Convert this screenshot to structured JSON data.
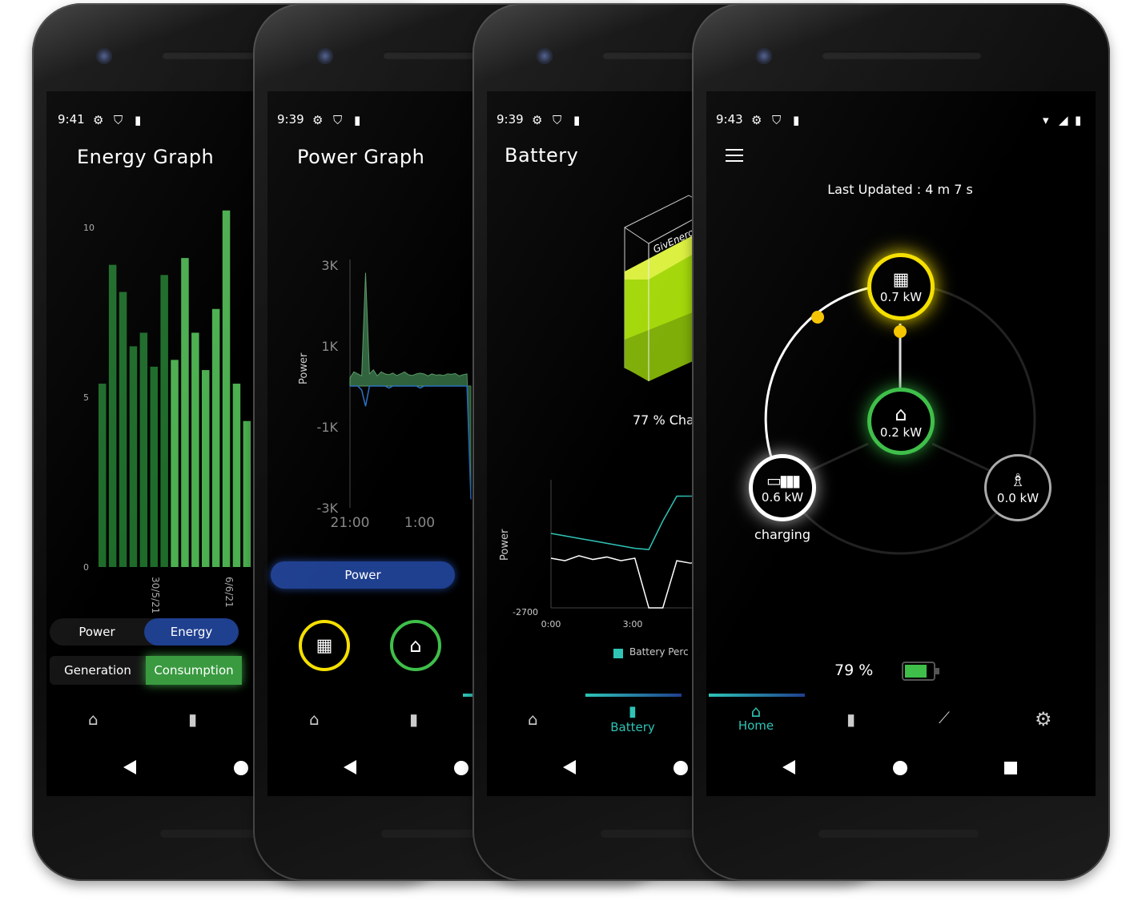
{
  "colors": {
    "accent_teal": "#2ec4b6",
    "nav_blue": "#1f3f8f",
    "solar_yellow": "#f5e000",
    "home_green": "#3fbf4a",
    "battery_lime": "#a4d80a"
  },
  "phone1": {
    "status_time": "9:41",
    "title": "Energy Graph",
    "mode_toggle": [
      "Power",
      "Energy"
    ],
    "mode_selected": "Energy",
    "type_toggle": [
      "Generation",
      "Consumption"
    ],
    "type_selected": "Consumption"
  },
  "phone2": {
    "status_time": "9:39",
    "title": "Power Graph",
    "power_tab": "Power"
  },
  "phone3": {
    "status_time": "9:39",
    "title": "Battery",
    "battery_brand": "GivEnergy",
    "charge_text": "77 % Cha",
    "legend": "Battery Perc",
    "nav_active_label": "Battery"
  },
  "phone4": {
    "status_time": "9:43",
    "last_updated": "Last Updated : 4 m 7 s",
    "solar": {
      "value": "0.7 kW",
      "icon": "solar-panel-icon"
    },
    "home": {
      "value": "0.2 kW",
      "icon": "house-icon"
    },
    "battery": {
      "value": "0.6 kW",
      "status": "charging",
      "icon": "battery-icon"
    },
    "grid": {
      "value": "0.0 kW",
      "icon": "pylon-icon"
    },
    "battery_percent": "79 %",
    "battery_level": 79,
    "nav_active_label": "Home"
  },
  "chart_data": [
    {
      "type": "bar",
      "ylim": [
        0,
        10.5
      ],
      "yticks": [
        "0",
        "5",
        "10"
      ],
      "xticks": [
        "30/5/21",
        "6/6/21"
      ],
      "values": [
        5.4,
        8.9,
        8.1,
        6.5,
        6.9,
        5.9,
        8.6,
        6.1,
        9.1,
        6.9,
        5.8,
        7.6,
        10.5,
        5.4,
        4.3
      ],
      "bar_colors": [
        "#1e6b2a",
        "#1e6b2a",
        "#1e6b2a",
        "#1e6b2a",
        "#1e6b2a",
        "#1e6b2a",
        "#1e6b2a",
        "#4caf50",
        "#4caf50",
        "#4caf50",
        "#4caf50",
        "#4caf50",
        "#4caf50",
        "#4caf50",
        "#4caf50"
      ]
    },
    {
      "type": "area",
      "ylabel": "Power",
      "yticks": [
        "3K",
        "1K",
        "-1K",
        "-3K"
      ],
      "xticks": [
        "21:00",
        "1:00"
      ],
      "ylim": [
        -3000,
        3000
      ],
      "series": [
        {
          "color": "#3a7a4a",
          "values": [
            200,
            350,
            300,
            250,
            2800,
            300,
            400,
            250,
            350,
            300,
            280,
            320,
            260,
            300,
            350,
            280,
            260,
            300,
            320,
            300,
            250,
            300,
            270,
            280,
            260,
            300,
            290,
            310,
            250,
            280,
            300,
            -2800
          ]
        },
        {
          "color": "#2a6fc0",
          "values": [
            0,
            0,
            0,
            -100,
            -500,
            0,
            0,
            0,
            0,
            0,
            -50,
            0,
            0,
            0,
            0,
            0,
            0,
            0,
            -50,
            0,
            0,
            0,
            0,
            0,
            0,
            0,
            0,
            0,
            0,
            0,
            0,
            -2800
          ]
        }
      ]
    },
    {
      "type": "line",
      "ylabel": "Power",
      "yticks": [
        "-2700"
      ],
      "xticks": [
        "0:00",
        "3:00"
      ],
      "series": [
        {
          "name": "Battery Perc",
          "color": "#2ec4b6",
          "values": [
            60,
            58,
            56,
            54,
            52,
            50,
            48,
            47,
            70,
            90,
            90,
            90
          ]
        },
        {
          "color": "#ffffff",
          "values": [
            40,
            38,
            42,
            39,
            41,
            38,
            40,
            0,
            0,
            38,
            36,
            40
          ]
        }
      ]
    }
  ]
}
